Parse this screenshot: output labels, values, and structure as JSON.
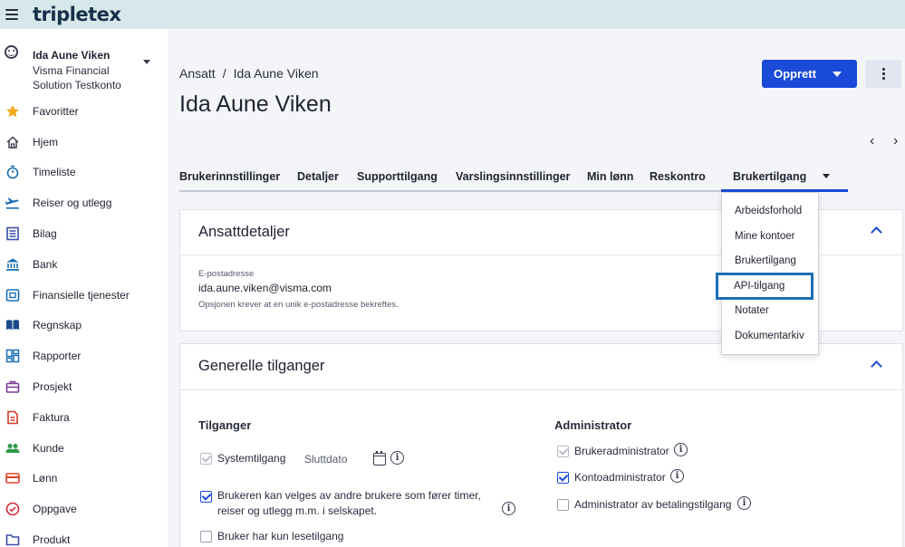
{
  "app": {
    "logo": "tripletex"
  },
  "account": {
    "name": "Ida Aune Viken",
    "org": "Visma Financial Solution Testkonto"
  },
  "sidebar": {
    "items": [
      {
        "label": "Favoritter",
        "icon": "star-icon"
      },
      {
        "label": "Hjem",
        "icon": "home-icon"
      },
      {
        "label": "Timeliste",
        "icon": "stopwatch-icon"
      },
      {
        "label": "Reiser og utlegg",
        "icon": "plane-icon"
      },
      {
        "label": "Bilag",
        "icon": "list-icon"
      },
      {
        "label": "Bank",
        "icon": "bank-icon"
      },
      {
        "label": "Finansielle tjenester",
        "icon": "finance-icon"
      },
      {
        "label": "Regnskap",
        "icon": "book-icon"
      },
      {
        "label": "Rapporter",
        "icon": "dashboard-icon"
      },
      {
        "label": "Prosjekt",
        "icon": "briefcase-icon"
      },
      {
        "label": "Faktura",
        "icon": "invoice-icon"
      },
      {
        "label": "Kunde",
        "icon": "people-icon"
      },
      {
        "label": "Lønn",
        "icon": "payslip-icon"
      },
      {
        "label": "Oppgave",
        "icon": "check-circle-icon"
      },
      {
        "label": "Produkt",
        "icon": "folder-icon"
      }
    ]
  },
  "breadcrumb": {
    "parent": "Ansatt",
    "separator": "/",
    "current": "Ida Aune Viken"
  },
  "page": {
    "title": "Ida Aune Viken"
  },
  "toolbar": {
    "create_label": "Opprett"
  },
  "tabs": [
    {
      "label": "Brukerinnstillinger"
    },
    {
      "label": "Detaljer"
    },
    {
      "label": "Supporttilgang"
    },
    {
      "label": "Varslingsinnstillinger"
    },
    {
      "label": "Min lønn"
    },
    {
      "label": "Reskontro"
    },
    {
      "label": "Brukertilgang"
    }
  ],
  "dropdown": {
    "items": [
      "Arbeidsforhold",
      "Mine kontoer",
      "Brukertilgang",
      "API-tilgang",
      "Notater",
      "Dokumentarkiv"
    ],
    "highlighted": "API-tilgang"
  },
  "employee_details": {
    "title": "Ansattdetaljer",
    "email_label": "E-postadresse",
    "email_value": "ida.aune.viken@visma.com",
    "email_help": "Opsjonen krever at en unik e-postadresse bekreftes."
  },
  "general_access": {
    "title": "Generelle tilganger",
    "access": {
      "heading": "Tilganger",
      "system_access": "Systemtilgang",
      "end_date": "Sluttdato",
      "selectable": "Brukeren kan velges av andre brukere som fører timer, reiser og utlegg m.m. i selskapet.",
      "read_only": "Bruker har kun lesetilgang"
    },
    "admin": {
      "heading": "Administrator",
      "user_admin": "Brukeradministrator",
      "account_admin": "Kontoadministrator",
      "payment_admin": "Administrator av betalingstilgang"
    }
  },
  "colors": {
    "accent": "#1a4ad8",
    "topbar": "#d6e8ea",
    "highlight_border": "#1a6fb4"
  }
}
